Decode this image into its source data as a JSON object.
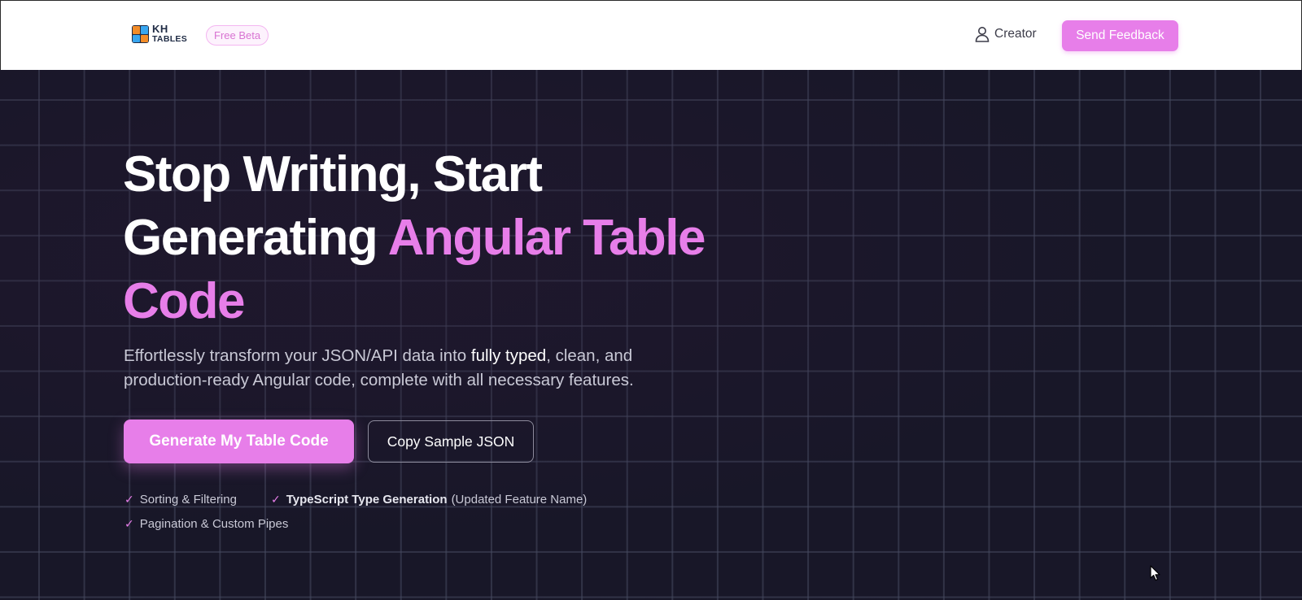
{
  "header": {
    "logo": {
      "line1": "KH",
      "line2": "TABLES"
    },
    "badge": "Free Beta",
    "creator_label": "Creator",
    "feedback_label": "Send Feedback"
  },
  "hero": {
    "headline": {
      "part1": "Stop Writing, Start",
      "part2": "Generating ",
      "accent": "Angular Table Code"
    },
    "subhead": {
      "part1": "Effortlessly transform your JSON/API data into ",
      "strong": "fully typed",
      "part2": ", clean, and production-ready Angular code, complete with all necessary features."
    },
    "primary_button": "Generate My Table Code",
    "secondary_button": "Copy Sample JSON",
    "features": [
      {
        "bold": "",
        "text": "Sorting & Filtering"
      },
      {
        "bold": "TypeScript Type Generation",
        "text": "(Updated Feature Name)"
      },
      {
        "bold": "",
        "text": "Pagination & Custom Pipes"
      }
    ]
  },
  "colors": {
    "accent": "#e77ee9",
    "background": "#181728",
    "header_bg": "#ffffff"
  },
  "icons": {
    "check": "check-icon",
    "user": "user-icon",
    "cursor": "mouse-cursor-icon"
  }
}
